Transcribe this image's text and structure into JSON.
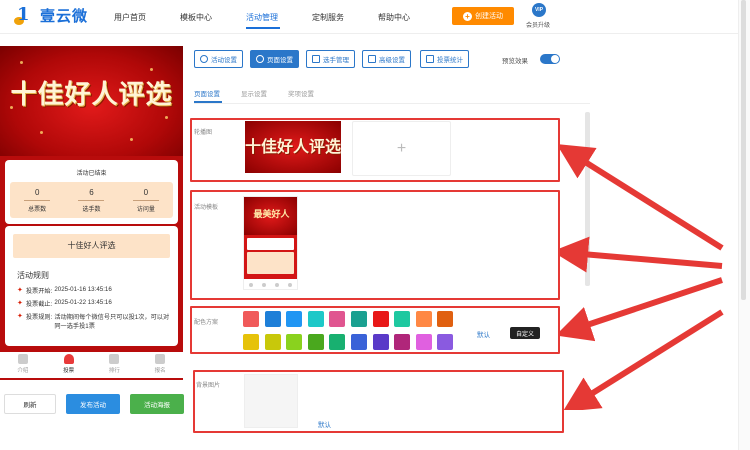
{
  "brand": {
    "name": "壹云微",
    "logo_digit": "1"
  },
  "nav": {
    "items": [
      {
        "label": "用户首页",
        "active": false
      },
      {
        "label": "模板中心",
        "active": false
      },
      {
        "label": "活动管理",
        "active": true
      },
      {
        "label": "定制服务",
        "active": false
      },
      {
        "label": "帮助中心",
        "active": false
      }
    ],
    "create_label": "创建活动",
    "vip_badge": "VIP",
    "vip_label": "会员升级"
  },
  "phone_preview": {
    "banner_title": "十佳好人评选",
    "status": "活动已结束",
    "stats": [
      {
        "value": "0",
        "label": "总票数"
      },
      {
        "value": "6",
        "label": "选手数"
      },
      {
        "value": "0",
        "label": "访问量"
      }
    ],
    "activity_title": "十佳好人评选",
    "rules_heading": "活动规则",
    "rules": [
      {
        "key": "投票开始:",
        "value": "2025-01-16 13:45:16"
      },
      {
        "key": "投票截止:",
        "value": "2025-01-22 13:45:16"
      },
      {
        "key": "投票规则:",
        "value": "活动期间每个微信号只可以投1次，可以对同一选手投1票"
      }
    ],
    "tabbar": [
      {
        "label": "介绍",
        "active": false
      },
      {
        "label": "投票",
        "active": true
      },
      {
        "label": "排行",
        "active": false
      },
      {
        "label": "报名",
        "active": false
      }
    ]
  },
  "bottom_buttons": {
    "refresh": "刷新",
    "publish": "发布活动",
    "poster": "活动海报"
  },
  "toolbar": {
    "tabs": [
      {
        "label": "活动设置",
        "active": false
      },
      {
        "label": "页面设置",
        "active": true
      },
      {
        "label": "选手管理",
        "active": false
      },
      {
        "label": "高级设置",
        "active": false
      },
      {
        "label": "投票统计",
        "active": false
      }
    ],
    "preview_label": "预览效果",
    "preview_on": true
  },
  "subtabs": [
    {
      "label": "页面设置",
      "active": true
    },
    {
      "label": "显示设置",
      "active": false
    },
    {
      "label": "奖项设置",
      "active": false
    }
  ],
  "sections": {
    "carousel": {
      "label": "轮播图",
      "slide_title": "十佳好人评选",
      "add_symbol": "+"
    },
    "template": {
      "label": "活动模板",
      "thumb_title": "最美好人"
    },
    "colors": {
      "label": "配色方案",
      "row1": [
        "#f05a5a",
        "#1e7fd8",
        "#2196f3",
        "#1ec8c8",
        "#e05590",
        "#1aa090",
        "#e81818",
        "#1ec8a0",
        "#ff8844",
        "#e06010"
      ],
      "row2": [
        "#e6c20a",
        "#c8c80a",
        "#8ad21e",
        "#4aa81e",
        "#18b070",
        "#3a62d8",
        "#5a3ac8",
        "#b0267a",
        "#e060e0",
        "#8a5ae0"
      ],
      "default_label": "默认",
      "custom_label": "自定义"
    },
    "background": {
      "label": "背景图片",
      "default_label": "默认"
    }
  },
  "colors": {
    "accent": "#2b77c9",
    "highlight_box": "#e53935",
    "create": "#ff8a00"
  }
}
